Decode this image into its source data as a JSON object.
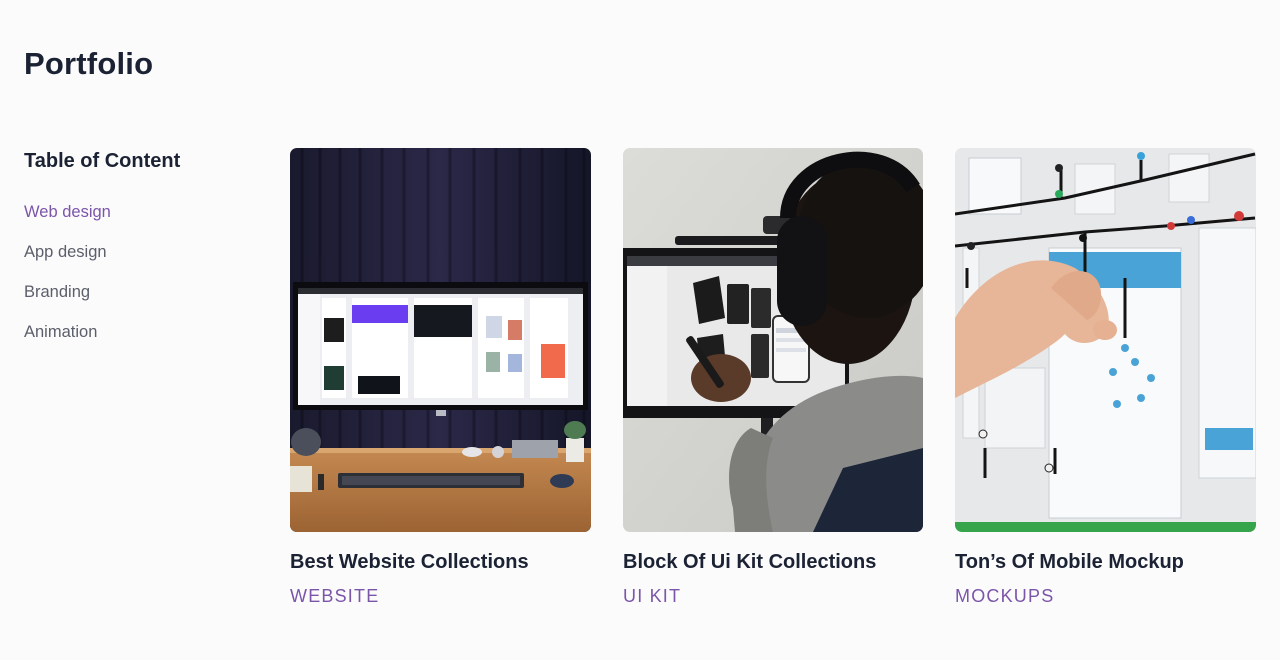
{
  "page": {
    "title": "Portfolio"
  },
  "toc": {
    "title": "Table of Content",
    "items": [
      {
        "label": "Web design",
        "active": true
      },
      {
        "label": "App design",
        "active": false
      },
      {
        "label": "Branding",
        "active": false
      },
      {
        "label": "Animation",
        "active": false
      }
    ]
  },
  "cards": [
    {
      "title": "Best Website Collections",
      "tag": "WEBSITE",
      "image": "desk-monitor-photo"
    },
    {
      "title": "Block Of Ui Kit Collections",
      "tag": "UI KIT",
      "image": "headphones-designer-photo"
    },
    {
      "title": "Ton’s Of Mobile Mockup",
      "tag": "MOCKUPS",
      "image": "whiteboard-wireframe-photo"
    }
  ],
  "colors": {
    "accent": "#7b55a8",
    "text": "#1b2233",
    "muted": "#5b5f69",
    "background": "#fbfbfc"
  }
}
